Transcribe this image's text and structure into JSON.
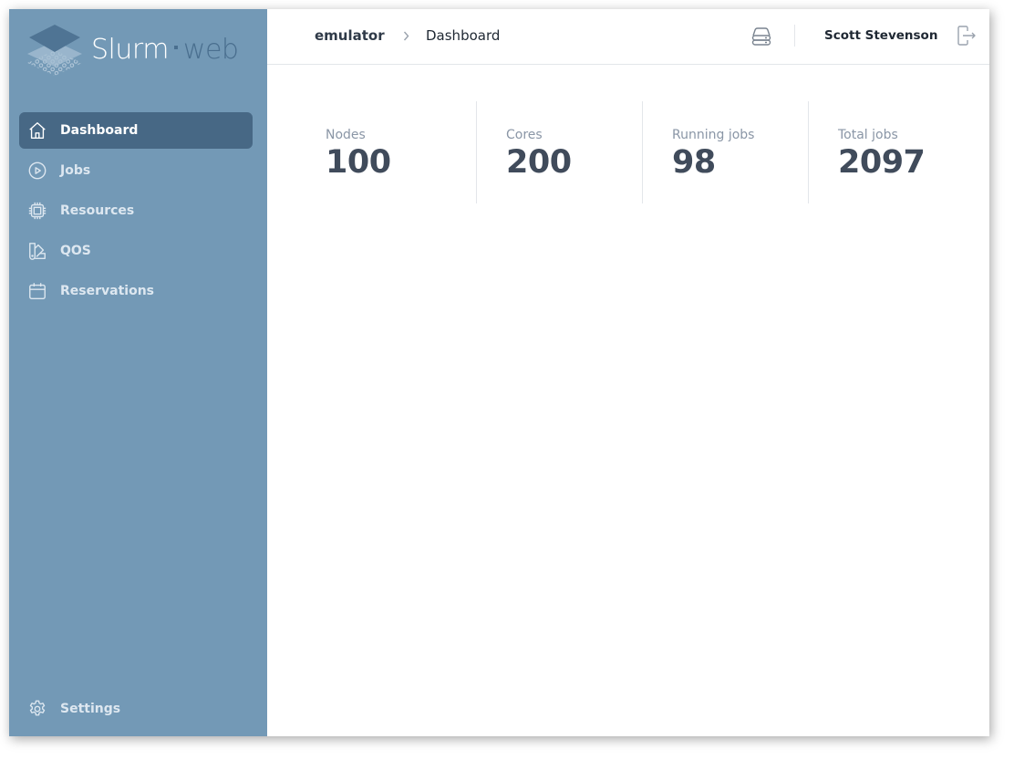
{
  "app": {
    "logo_primary": "Slurm",
    "logo_secondary": "web"
  },
  "sidebar": {
    "items": [
      {
        "label": "Dashboard",
        "icon": "home-icon",
        "active": true
      },
      {
        "label": "Jobs",
        "icon": "play-circle-icon",
        "active": false
      },
      {
        "label": "Resources",
        "icon": "cpu-chip-icon",
        "active": false
      },
      {
        "label": "QOS",
        "icon": "swatch-icon",
        "active": false
      },
      {
        "label": "Reservations",
        "icon": "calendar-icon",
        "active": false
      }
    ],
    "settings_label": "Settings"
  },
  "header": {
    "cluster": "emulator",
    "separator": ">",
    "page": "Dashboard",
    "user": "Scott Stevenson"
  },
  "stats": [
    {
      "label": "Nodes",
      "value": "100"
    },
    {
      "label": "Cores",
      "value": "200"
    },
    {
      "label": "Running jobs",
      "value": "98"
    },
    {
      "label": "Total jobs",
      "value": "2097"
    }
  ],
  "colors": {
    "sidebar_bg": "#7399b6",
    "sidebar_active": "#476885",
    "text_dark": "#404b5b",
    "text_muted": "#8a96a6"
  }
}
